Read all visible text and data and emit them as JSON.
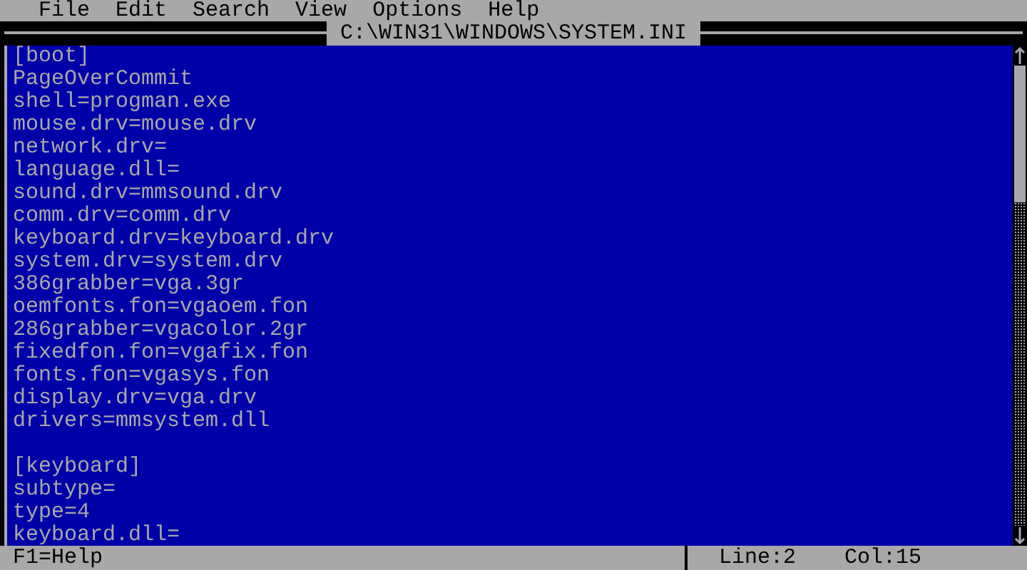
{
  "menu_bar": [
    "File",
    "Edit",
    "Search",
    "View",
    "Options",
    "Help"
  ],
  "window": {
    "title": "C:\\WIN31\\WINDOWS\\SYSTEM.INI"
  },
  "editor": {
    "sections": [
      {
        "header": "[boot]",
        "lines": [
          "PageOverCommit",
          "shell=progman.exe",
          "mouse.drv=mouse.drv",
          "network.drv=",
          "language.dll=",
          "sound.drv=mmsound.drv",
          "comm.drv=comm.drv",
          "keyboard.drv=keyboard.drv",
          "system.drv=system.drv",
          "386grabber=vga.3gr",
          "oemfonts.fon=vgaoem.fon",
          "286grabber=vgacolor.2gr",
          "fixedfon.fon=vgafix.fon",
          "fonts.fon=vgasys.fon",
          "display.drv=vga.drv",
          "drivers=mmsystem.dll"
        ]
      },
      {
        "header": "[keyboard]",
        "lines": [
          "subtype=",
          "type=4",
          "keyboard.dll="
        ]
      }
    ]
  },
  "status_bar": {
    "help": "F1=Help",
    "line": "Line:2",
    "column": "Col:15"
  }
}
